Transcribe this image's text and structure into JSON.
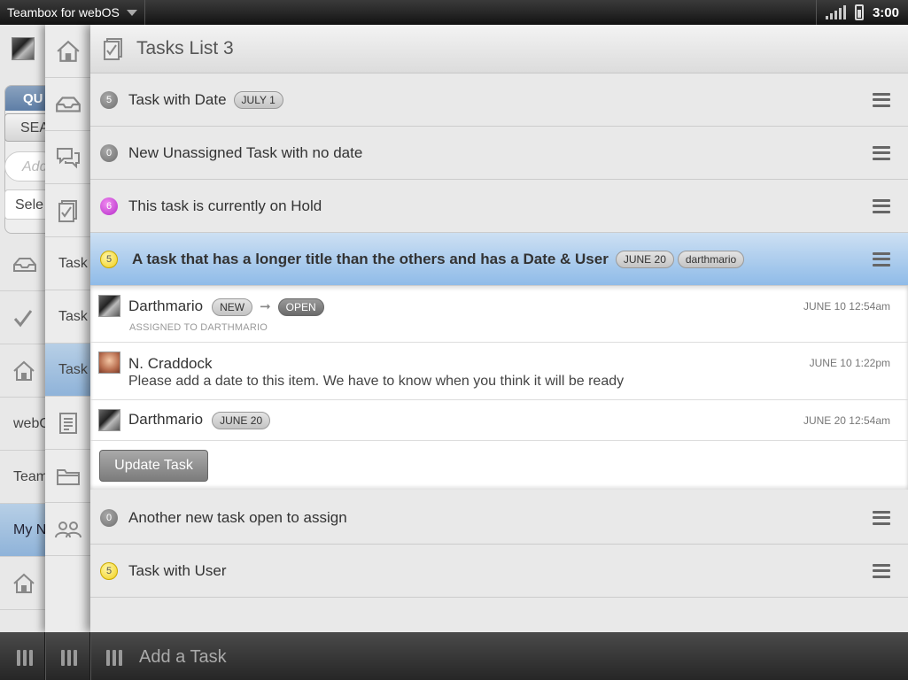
{
  "statusbar": {
    "app_name": "Teambox for webOS",
    "time": "3:00"
  },
  "panel1": {
    "quick_header": "QU",
    "search_label": "SEA",
    "input_placeholder": "Add",
    "select_label": "Sele",
    "rows": [
      "",
      "",
      "",
      "webO",
      "Team",
      "My N",
      ""
    ]
  },
  "panel2": {
    "rows": [
      "Task",
      "Task",
      "Task"
    ]
  },
  "main": {
    "title": "Tasks List 3",
    "tasks": [
      {
        "count": "5",
        "title": "Task with Date",
        "tags": [
          "JULY 1"
        ]
      },
      {
        "count": "0",
        "title": "New Unassigned Task with no date",
        "tags": []
      },
      {
        "count": "6",
        "title": "This task is currently on Hold",
        "tags": []
      },
      {
        "count": "5",
        "title": "A task that has a longer title than the others and has a Date & User",
        "tags": [
          "JUNE 20",
          "darthmario"
        ]
      },
      {
        "count": "0",
        "title": "Another new task open to assign",
        "tags": []
      },
      {
        "count": "5",
        "title": "Task with User",
        "tags": []
      }
    ],
    "detail": {
      "comments": [
        {
          "author": "Darthmario",
          "status_from": "NEW",
          "status_to": "OPEN",
          "timestamp": "JUNE 10 12:54am",
          "note": "ASSIGNED TO DARTHMARIO"
        },
        {
          "author": "N. Craddock",
          "timestamp": "JUNE 10 1:22pm",
          "body": "Please add a date to this item. We have to  know when you think it will be ready"
        },
        {
          "author": "Darthmario",
          "due": "JUNE 20",
          "timestamp": "JUNE 20 12:54am"
        }
      ],
      "update_button": "Update Task"
    }
  },
  "bottombar": {
    "add_task_label": "Add a Task"
  },
  "colors": {
    "selection": "#8fbbe8",
    "on_hold": "#b52bc9",
    "active": "#f1cf1b",
    "idle": "#6e6e6e"
  }
}
